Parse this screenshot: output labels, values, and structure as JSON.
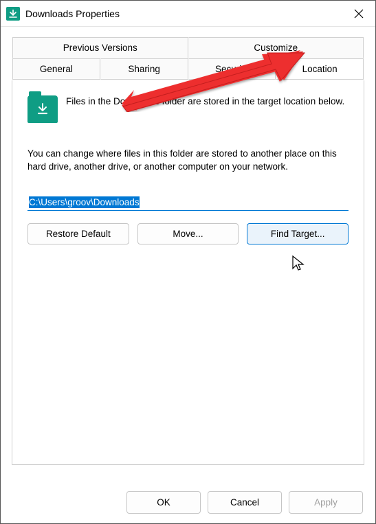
{
  "titlebar": {
    "title": "Downloads Properties"
  },
  "tabs": {
    "row1": [
      "Previous Versions",
      "Customize"
    ],
    "row2": [
      "General",
      "Sharing",
      "Security",
      "Location"
    ],
    "active": "Location"
  },
  "location": {
    "desc": "Files in the Downloads folder are stored in the target location below.",
    "change": "You can change where files in this folder are stored to another place on this hard drive, another drive, or another computer on your network.",
    "path": "C:\\Users\\groov\\Downloads",
    "buttons": {
      "restore": "Restore Default",
      "move": "Move...",
      "find": "Find Target..."
    }
  },
  "footer": {
    "ok": "OK",
    "cancel": "Cancel",
    "apply": "Apply"
  }
}
